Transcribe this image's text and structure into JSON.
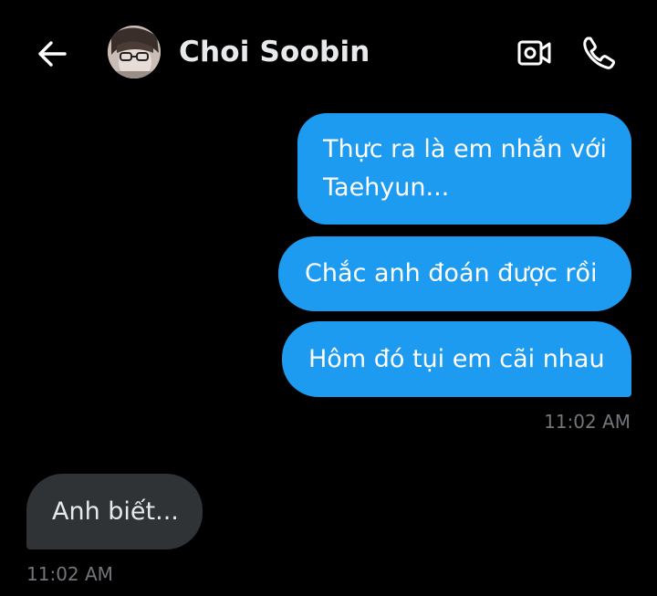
{
  "header": {
    "contact_name": "Choi Soobin",
    "back_icon": "arrow-left-icon",
    "video_icon": "video-camera-icon",
    "call_icon": "phone-icon"
  },
  "messages": [
    {
      "direction": "sent",
      "text": "Thực ra là em nhắn với Taehyun..."
    },
    {
      "direction": "sent",
      "text": "Chắc anh đoán được rồi"
    },
    {
      "direction": "sent",
      "text": "Hôm đó tụi em cãi nhau"
    },
    {
      "direction": "received",
      "text": "Anh biết..."
    }
  ],
  "timestamps": {
    "sent_group": "11:02 AM",
    "received_group": "11:02 AM"
  },
  "colors": {
    "background": "#000000",
    "sent_bubble": "#1d9bf0",
    "received_bubble": "#2f3336",
    "timestamp_text": "#71767b"
  }
}
